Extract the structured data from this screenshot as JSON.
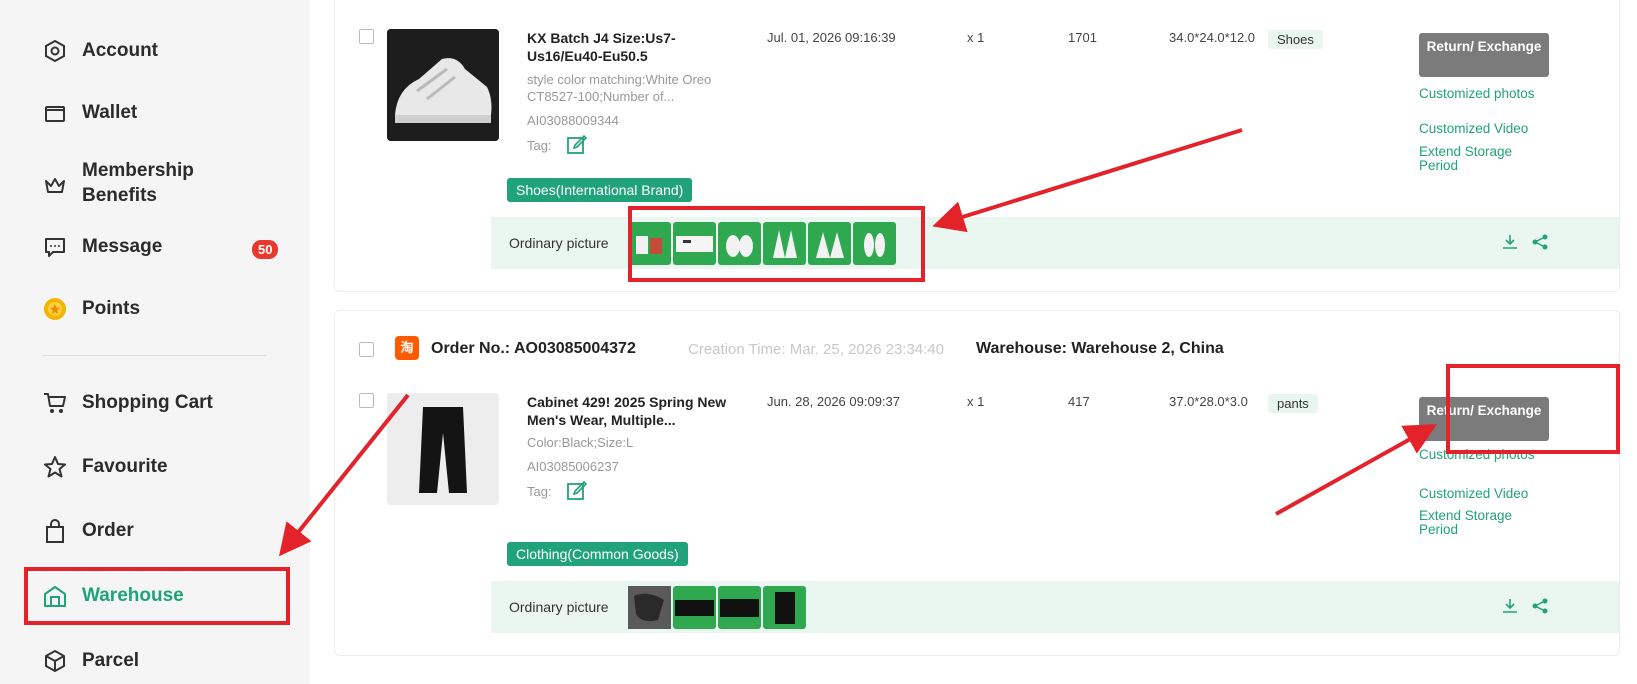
{
  "sidebar": {
    "items": [
      {
        "label": "Account",
        "icon": "account-hexagon-icon"
      },
      {
        "label": "Wallet",
        "icon": "wallet-icon"
      },
      {
        "label": "Membership\nBenefits",
        "icon": "crown-icon"
      },
      {
        "label": "Message",
        "icon": "message-icon",
        "badge": "50"
      },
      {
        "label": "Points",
        "icon": "coin-icon"
      },
      {
        "label": "Shopping Cart",
        "icon": "cart-icon"
      },
      {
        "label": "Favourite",
        "icon": "star-icon"
      },
      {
        "label": "Order",
        "icon": "bag-icon"
      },
      {
        "label": "Warehouse",
        "icon": "warehouse-icon",
        "active": true
      },
      {
        "label": "Parcel",
        "icon": "parcel-icon"
      }
    ]
  },
  "orders": [
    {
      "item": {
        "title": "KX Batch J4 Size:Us7-Us16/Eu40-Eu50.5",
        "spec": "style color matching:White Oreo CT8527-100;Number of...",
        "sku": "AI03088009344",
        "tag_label": "Tag:",
        "time": "Jul. 01, 2026 09:16:39",
        "qty": "x 1",
        "weight": "1701",
        "dims": "34.0*24.0*12.0",
        "type_tag": "Shoes",
        "action": "Return/ Exchange",
        "links": [
          "Customized photos",
          "Customized Video",
          "Extend Storage Period"
        ],
        "category": "Shoes(International Brand)",
        "pic_label": "Ordinary picture",
        "pic_count": 6
      }
    },
    {
      "order_no_label": "Order No.: AO03085004372",
      "creation_time": "Creation Time: Mar. 25, 2026 23:34:40",
      "warehouse": "Warehouse: Warehouse 2, China",
      "shop_icon": "淘",
      "item": {
        "title": "Cabinet 429! 2025 Spring New Men's Wear, Multiple...",
        "spec": "Color:Black;Size:L",
        "sku": "AI03085006237",
        "tag_label": "Tag:",
        "time": "Jun. 28, 2026 09:09:37",
        "qty": "x 1",
        "weight": "417",
        "dims": "37.0*28.0*3.0",
        "type_tag": "pants",
        "action": "Return/ Exchange",
        "links": [
          "Customized photos",
          "Customized Video",
          "Extend Storage Period"
        ],
        "category": "Clothing(Common Goods)",
        "pic_label": "Ordinary picture",
        "pic_count": 4
      }
    }
  ],
  "colors": {
    "accent": "#20a37a",
    "highlight": "#e3222a",
    "button": "#7b7b7b"
  }
}
